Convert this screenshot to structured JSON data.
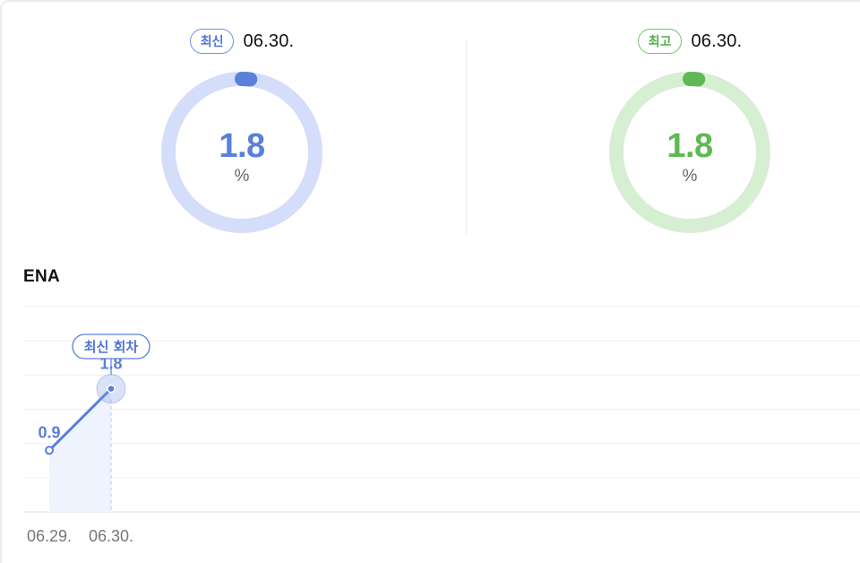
{
  "stats": {
    "latest": {
      "badge": "최신",
      "date": "06.30.",
      "value": "1.8",
      "unit": "%",
      "fraction": 0.018,
      "color": "#5a7fdc",
      "track_color": "#d4defa"
    },
    "best": {
      "badge": "최고",
      "date": "06.30.",
      "value": "1.8",
      "unit": "%",
      "fraction": 0.018,
      "color": "#5fb855",
      "track_color": "#d6efd2"
    }
  },
  "section": {
    "title": "ENA"
  },
  "chart_data": {
    "type": "line",
    "categories": [
      "06.29.",
      "06.30."
    ],
    "series": [
      {
        "values": [
          0.9,
          1.8
        ]
      }
    ],
    "data_labels": [
      "0.9",
      "1.8"
    ],
    "highlight": {
      "label": "최신 회차",
      "index": 1
    },
    "ylim": [
      0,
      3
    ],
    "grid": true,
    "line_color": "#5a7fdc"
  }
}
